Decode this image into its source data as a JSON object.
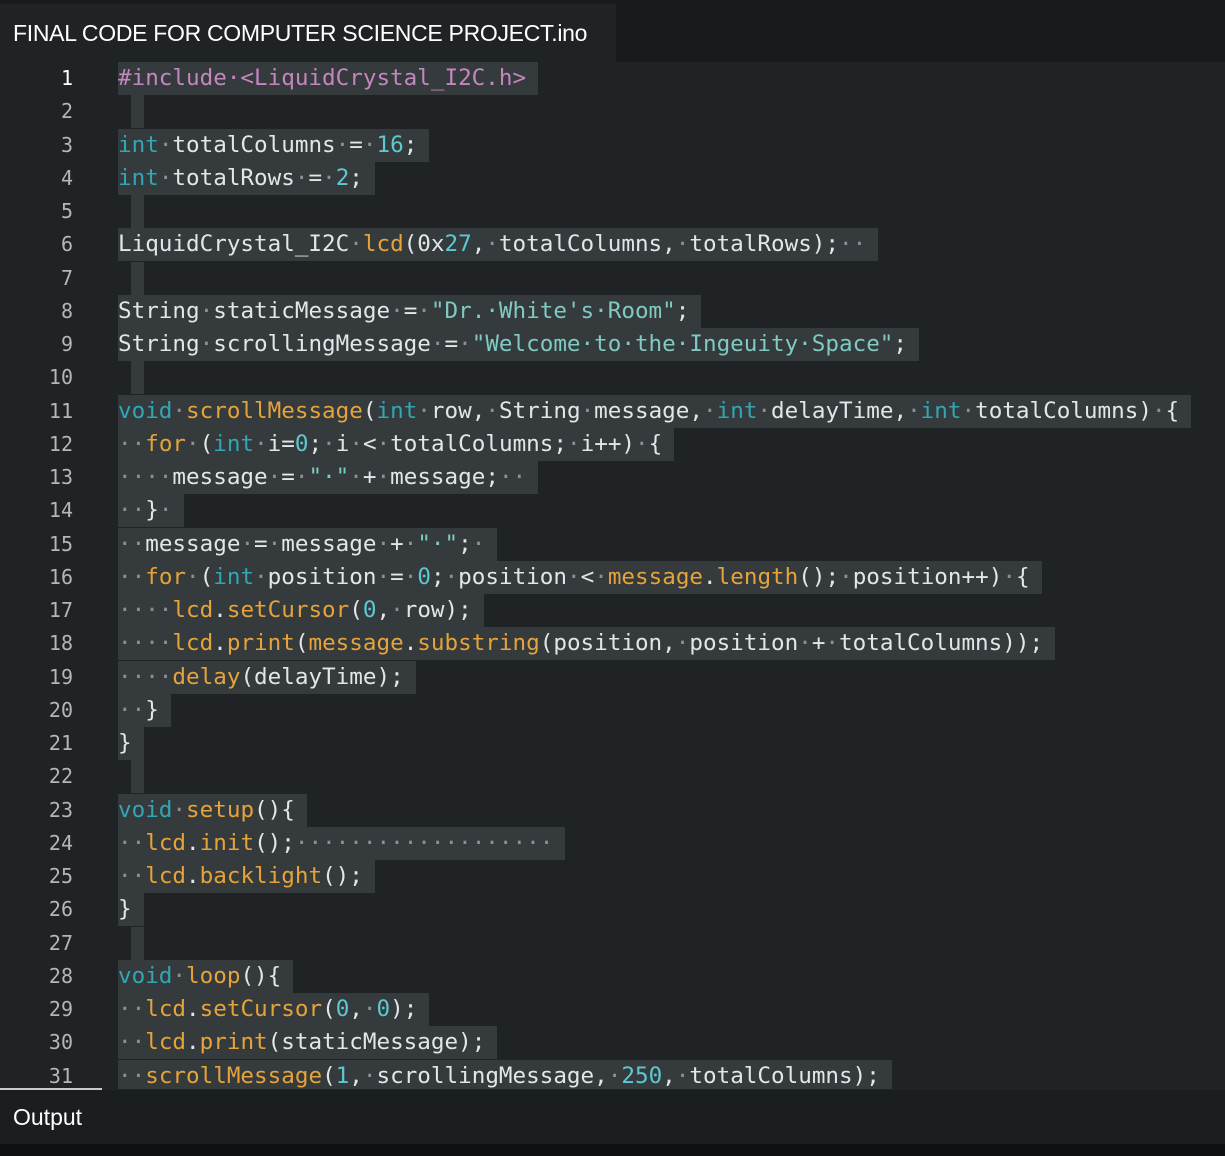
{
  "tab": {
    "title": "FINAL CODE FOR COMPUTER SCIENCE PROJECT.ino"
  },
  "panel": {
    "output_label": "Output"
  },
  "colors": {
    "background": "#1f2326",
    "selection": "#353a3d",
    "keyword": "#2fa7b4",
    "preprocessor": "#c586c0",
    "function": "#e5a33a",
    "number": "#5cc9d0",
    "string": "#7fcac3",
    "whitespace_marker": "#8b9095"
  },
  "lines": [
    {
      "n": "1",
      "t": [
        [
          "pp",
          "#include·<LiquidCrystal_I2C.h>"
        ]
      ]
    },
    {
      "n": "2",
      "t": []
    },
    {
      "n": "3",
      "t": [
        [
          "kw",
          "int"
        ],
        [
          "ws",
          "·"
        ],
        [
          "",
          "totalColumns"
        ],
        [
          "ws",
          "·"
        ],
        [
          "",
          "="
        ],
        [
          "ws",
          "·"
        ],
        [
          "num",
          "16"
        ],
        [
          "",
          ";"
        ]
      ]
    },
    {
      "n": "4",
      "t": [
        [
          "kw",
          "int"
        ],
        [
          "ws",
          "·"
        ],
        [
          "",
          "totalRows"
        ],
        [
          "ws",
          "·"
        ],
        [
          "",
          "="
        ],
        [
          "ws",
          "·"
        ],
        [
          "num",
          "2"
        ],
        [
          "",
          ";"
        ]
      ]
    },
    {
      "n": "5",
      "t": []
    },
    {
      "n": "6",
      "t": [
        [
          "",
          "LiquidCrystal_I2C"
        ],
        [
          "ws",
          "·"
        ],
        [
          "fn",
          "lcd"
        ],
        [
          "",
          "(0x"
        ],
        [
          "num",
          "27"
        ],
        [
          "",
          ","
        ],
        [
          "ws",
          "·"
        ],
        [
          "",
          "totalColumns,"
        ],
        [
          "ws",
          "·"
        ],
        [
          "",
          "totalRows);"
        ],
        [
          "ws",
          "··"
        ]
      ]
    },
    {
      "n": "7",
      "t": []
    },
    {
      "n": "8",
      "t": [
        [
          "",
          "String"
        ],
        [
          "ws",
          "·"
        ],
        [
          "",
          "staticMessage"
        ],
        [
          "ws",
          "·"
        ],
        [
          "",
          "="
        ],
        [
          "ws",
          "·"
        ],
        [
          "str",
          "\"Dr.·White's·Room\""
        ],
        [
          "",
          ";"
        ]
      ]
    },
    {
      "n": "9",
      "t": [
        [
          "",
          "String"
        ],
        [
          "ws",
          "·"
        ],
        [
          "",
          "scrollingMessage"
        ],
        [
          "ws",
          "·"
        ],
        [
          "",
          "="
        ],
        [
          "ws",
          "·"
        ],
        [
          "str",
          "\"Welcome·to·the·Ingeuity·Space\""
        ],
        [
          "",
          ";"
        ]
      ]
    },
    {
      "n": "10",
      "t": []
    },
    {
      "n": "11",
      "t": [
        [
          "kw",
          "void"
        ],
        [
          "ws",
          "·"
        ],
        [
          "fn",
          "scrollMessage"
        ],
        [
          "",
          "("
        ],
        [
          "kw",
          "int"
        ],
        [
          "ws",
          "·"
        ],
        [
          "",
          "row,"
        ],
        [
          "ws",
          "·"
        ],
        [
          "",
          "String"
        ],
        [
          "ws",
          "·"
        ],
        [
          "",
          "message,"
        ],
        [
          "ws",
          "·"
        ],
        [
          "kw",
          "int"
        ],
        [
          "ws",
          "·"
        ],
        [
          "",
          "delayTime,"
        ],
        [
          "ws",
          "·"
        ],
        [
          "kw",
          "int"
        ],
        [
          "ws",
          "·"
        ],
        [
          "",
          "totalColumns)"
        ],
        [
          "ws",
          "·"
        ],
        [
          "",
          "{"
        ]
      ]
    },
    {
      "n": "12",
      "t": [
        [
          "ws",
          "··"
        ],
        [
          "fn",
          "for"
        ],
        [
          "ws",
          "·"
        ],
        [
          "",
          "("
        ],
        [
          "kw",
          "int"
        ],
        [
          "ws",
          "·"
        ],
        [
          "",
          "i="
        ],
        [
          "num",
          "0"
        ],
        [
          "",
          ";"
        ],
        [
          "ws",
          "·"
        ],
        [
          "",
          "i"
        ],
        [
          "ws",
          "·"
        ],
        [
          "",
          "<"
        ],
        [
          "ws",
          "·"
        ],
        [
          "",
          "totalColumns;"
        ],
        [
          "ws",
          "·"
        ],
        [
          "",
          "i++)"
        ],
        [
          "ws",
          "·"
        ],
        [
          "",
          "{"
        ]
      ]
    },
    {
      "n": "13",
      "t": [
        [
          "ws",
          "····"
        ],
        [
          "",
          "message"
        ],
        [
          "ws",
          "·"
        ],
        [
          "",
          "="
        ],
        [
          "ws",
          "·"
        ],
        [
          "str",
          "\"·\""
        ],
        [
          "ws",
          "·"
        ],
        [
          "",
          "+"
        ],
        [
          "ws",
          "·"
        ],
        [
          "",
          "message;"
        ],
        [
          "ws",
          "··"
        ]
      ]
    },
    {
      "n": "14",
      "t": [
        [
          "ws",
          "··"
        ],
        [
          "",
          "}"
        ],
        [
          "ws",
          "·"
        ]
      ]
    },
    {
      "n": "15",
      "t": [
        [
          "ws",
          "··"
        ],
        [
          "",
          "message"
        ],
        [
          "ws",
          "·"
        ],
        [
          "",
          "="
        ],
        [
          "ws",
          "·"
        ],
        [
          "",
          "message"
        ],
        [
          "ws",
          "·"
        ],
        [
          "",
          "+"
        ],
        [
          "ws",
          "·"
        ],
        [
          "str",
          "\"·\""
        ],
        [
          "",
          ";"
        ],
        [
          "ws",
          "·"
        ]
      ]
    },
    {
      "n": "16",
      "t": [
        [
          "ws",
          "··"
        ],
        [
          "fn",
          "for"
        ],
        [
          "ws",
          "·"
        ],
        [
          "",
          "("
        ],
        [
          "kw",
          "int"
        ],
        [
          "ws",
          "·"
        ],
        [
          "",
          "position"
        ],
        [
          "ws",
          "·"
        ],
        [
          "",
          "="
        ],
        [
          "ws",
          "·"
        ],
        [
          "num",
          "0"
        ],
        [
          "",
          ";"
        ],
        [
          "ws",
          "·"
        ],
        [
          "",
          "position"
        ],
        [
          "ws",
          "·"
        ],
        [
          "",
          "<"
        ],
        [
          "ws",
          "·"
        ],
        [
          "fn",
          "message"
        ],
        [
          "",
          "."
        ],
        [
          "fn",
          "length"
        ],
        [
          "",
          "();"
        ],
        [
          "ws",
          "·"
        ],
        [
          "",
          "position++)"
        ],
        [
          "ws",
          "·"
        ],
        [
          "",
          "{"
        ]
      ]
    },
    {
      "n": "17",
      "t": [
        [
          "ws",
          "····"
        ],
        [
          "fn",
          "lcd"
        ],
        [
          "",
          "."
        ],
        [
          "fn",
          "setCursor"
        ],
        [
          "",
          "("
        ],
        [
          "num",
          "0"
        ],
        [
          "",
          ","
        ],
        [
          "ws",
          "·"
        ],
        [
          "",
          "row);"
        ]
      ]
    },
    {
      "n": "18",
      "t": [
        [
          "ws",
          "····"
        ],
        [
          "fn",
          "lcd"
        ],
        [
          "",
          "."
        ],
        [
          "fn",
          "print"
        ],
        [
          "",
          "("
        ],
        [
          "fn",
          "message"
        ],
        [
          "",
          "."
        ],
        [
          "fn",
          "substring"
        ],
        [
          "",
          "(position,"
        ],
        [
          "ws",
          "·"
        ],
        [
          "",
          "position"
        ],
        [
          "ws",
          "·"
        ],
        [
          "",
          "+"
        ],
        [
          "ws",
          "·"
        ],
        [
          "",
          "totalColumns));"
        ]
      ]
    },
    {
      "n": "19",
      "t": [
        [
          "ws",
          "····"
        ],
        [
          "fn",
          "delay"
        ],
        [
          "",
          "(delayTime);"
        ]
      ]
    },
    {
      "n": "20",
      "t": [
        [
          "ws",
          "··"
        ],
        [
          "",
          "}"
        ]
      ]
    },
    {
      "n": "21",
      "t": [
        [
          "",
          "}"
        ]
      ]
    },
    {
      "n": "22",
      "t": []
    },
    {
      "n": "23",
      "t": [
        [
          "kw",
          "void"
        ],
        [
          "ws",
          "·"
        ],
        [
          "fn",
          "setup"
        ],
        [
          "",
          "(){"
        ]
      ]
    },
    {
      "n": "24",
      "t": [
        [
          "ws",
          "··"
        ],
        [
          "fn",
          "lcd"
        ],
        [
          "",
          "."
        ],
        [
          "fn",
          "init"
        ],
        [
          "",
          "();"
        ],
        [
          "ws",
          "···················"
        ]
      ]
    },
    {
      "n": "25",
      "t": [
        [
          "ws",
          "··"
        ],
        [
          "fn",
          "lcd"
        ],
        [
          "",
          "."
        ],
        [
          "fn",
          "backlight"
        ],
        [
          "",
          "();"
        ]
      ]
    },
    {
      "n": "26",
      "t": [
        [
          "",
          "}"
        ]
      ]
    },
    {
      "n": "27",
      "t": []
    },
    {
      "n": "28",
      "t": [
        [
          "kw",
          "void"
        ],
        [
          "ws",
          "·"
        ],
        [
          "fn",
          "loop"
        ],
        [
          "",
          "(){"
        ]
      ]
    },
    {
      "n": "29",
      "t": [
        [
          "ws",
          "··"
        ],
        [
          "fn",
          "lcd"
        ],
        [
          "",
          "."
        ],
        [
          "fn",
          "setCursor"
        ],
        [
          "",
          "("
        ],
        [
          "num",
          "0"
        ],
        [
          "",
          ","
        ],
        [
          "ws",
          "·"
        ],
        [
          "num",
          "0"
        ],
        [
          "",
          ");"
        ]
      ]
    },
    {
      "n": "30",
      "t": [
        [
          "ws",
          "··"
        ],
        [
          "fn",
          "lcd"
        ],
        [
          "",
          "."
        ],
        [
          "fn",
          "print"
        ],
        [
          "",
          "(staticMessage);"
        ]
      ]
    },
    {
      "n": "31",
      "t": [
        [
          "ws",
          "··"
        ],
        [
          "fn",
          "scrollMessage"
        ],
        [
          "",
          "("
        ],
        [
          "num",
          "1"
        ],
        [
          "",
          ","
        ],
        [
          "ws",
          "·"
        ],
        [
          "",
          "scrollingMessage,"
        ],
        [
          "ws",
          "·"
        ],
        [
          "num",
          "250"
        ],
        [
          "",
          ","
        ],
        [
          "ws",
          "·"
        ],
        [
          "",
          "totalColumns);"
        ]
      ]
    }
  ]
}
